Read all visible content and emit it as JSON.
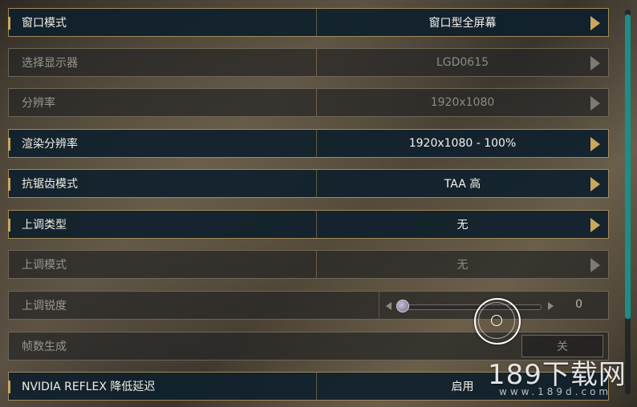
{
  "settings": [
    {
      "label": "窗口模式",
      "value": "窗口型全屏幕",
      "enabled": true
    },
    {
      "label": "选择显示器",
      "value": "LGD0615",
      "enabled": false
    },
    {
      "label": "分辨率",
      "value": "1920x1080",
      "enabled": false
    },
    {
      "label": "渲染分辨率",
      "value": "1920x1080 - 100%",
      "enabled": true
    },
    {
      "label": "抗锯齿模式",
      "value": "TAA 高",
      "enabled": true
    },
    {
      "label": "上调类型",
      "value": "无",
      "enabled": true
    },
    {
      "label": "上调模式",
      "value": "无",
      "enabled": false
    }
  ],
  "sharpness": {
    "label": "上调锐度",
    "value": "0",
    "level": 0
  },
  "frame_gen": {
    "label": "帧数生成",
    "button": "关"
  },
  "reflex": {
    "label": "NVIDIA REFLEX 降低延迟",
    "value": "启用"
  },
  "watermark": {
    "brand": "189下载网",
    "url": "www.189d.com"
  },
  "colors": {
    "accent": "#c9a85b",
    "scroll": "#1a8f8a"
  }
}
